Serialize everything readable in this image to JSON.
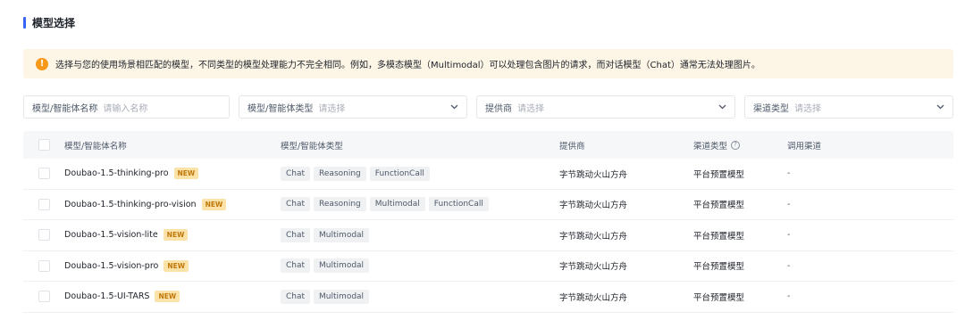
{
  "section": {
    "title": "模型选择"
  },
  "notice": {
    "icon": "warning-icon",
    "text": "选择与您的使用场景相匹配的模型，不同类型的模型处理能力不完全相同。例如，多模态模型（Multimodal）可以处理包含图片的请求，而对话模型（Chat）通常无法处理图片。"
  },
  "filters": {
    "name": {
      "label": "模型/智能体名称",
      "placeholder": "请输入名称"
    },
    "type": {
      "label": "模型/智能体类型",
      "placeholder": "请选择"
    },
    "provider": {
      "label": "提供商",
      "placeholder": "请选择"
    },
    "channel": {
      "label": "渠道类型",
      "placeholder": "请选择"
    }
  },
  "table": {
    "headers": {
      "name": "模型/智能体名称",
      "type": "模型/智能体类型",
      "provider": "提供商",
      "channel": "渠道类型",
      "call": "调用渠道"
    },
    "rows": [
      {
        "name": "Doubao-1.5-thinking-pro",
        "badge": "NEW",
        "tags": [
          "Chat",
          "Reasoning",
          "FunctionCall"
        ],
        "provider": "字节跳动火山方舟",
        "channel": "平台预置模型",
        "call": "-"
      },
      {
        "name": "Doubao-1.5-thinking-pro-vision",
        "badge": "NEW",
        "tags": [
          "Chat",
          "Reasoning",
          "Multimodal",
          "FunctionCall"
        ],
        "provider": "字节跳动火山方舟",
        "channel": "平台预置模型",
        "call": "-"
      },
      {
        "name": "Doubao-1.5-vision-lite",
        "badge": "NEW",
        "tags": [
          "Chat",
          "Multimodal"
        ],
        "provider": "字节跳动火山方舟",
        "channel": "平台预置模型",
        "call": "-"
      },
      {
        "name": "Doubao-1.5-vision-pro",
        "badge": "NEW",
        "tags": [
          "Chat",
          "Multimodal"
        ],
        "provider": "字节跳动火山方舟",
        "channel": "平台预置模型",
        "call": "-"
      },
      {
        "name": "Doubao-1.5-UI-TARS",
        "badge": "NEW",
        "tags": [
          "Chat",
          "Multimodal"
        ],
        "provider": "字节跳动火山方舟",
        "channel": "平台预置模型",
        "call": "-"
      }
    ]
  },
  "colors": {
    "accent": "#3964f5",
    "warning": "#f79a1a",
    "notice_bg": "#fdf6e6",
    "badge_bg": "#fbe2a8",
    "badge_text": "#c0780a"
  }
}
